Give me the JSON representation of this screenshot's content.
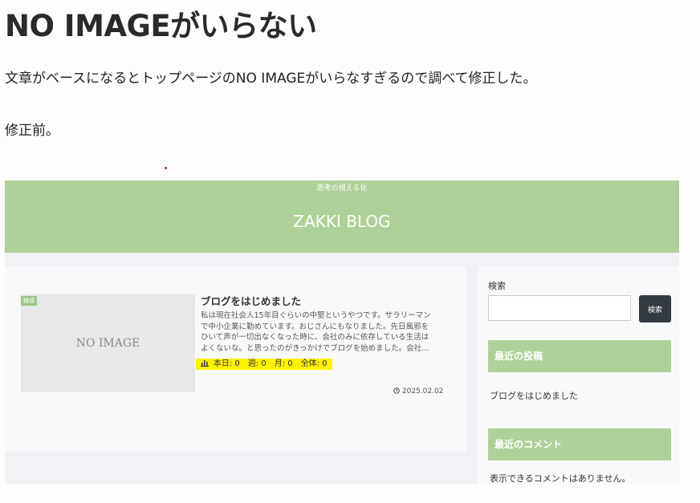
{
  "article": {
    "title": "NO IMAGEがいらない",
    "para1": "文章がベースになるとトップページのNO IMAGEがいらなすぎるので調べて修正した。",
    "para2": "修正前。"
  },
  "screenshot": {
    "tagline": "思考の視える化",
    "blog_title": "ZAKKI BLOG",
    "post": {
      "category": "雑感",
      "noimage_text": "NO IMAGE",
      "title": "ブログをはじめました",
      "excerpt": [
        "私は現在社会人15年目ぐらいの中堅というやつです。サラリーマン",
        "で中小企業に勤めています。おじさんにもなりました。先日風邪を",
        "ひいて声が一切出なくなった時に、会社のみに依存している生活は",
        "よくないな。と思ったのがきっかけでブログを始めました。会社…"
      ],
      "views": "本日: 0　週: 0　月: 0　全体: 0",
      "date": "2025.02.02"
    },
    "sidebar": {
      "search_label": "検索",
      "search_placeholder": "",
      "search_button": "検索",
      "recent_heading": "最近の投稿",
      "recent_item": "ブログをはじめました",
      "comments_heading": "最近のコメント",
      "no_comments": "表示できるコメントはありません。"
    },
    "colors": {
      "accent_green": "#aed199",
      "highlight_yellow": "#fff100",
      "search_button_bg": "#333a41"
    },
    "icons": [
      "bar-chart-icon",
      "clock-icon"
    ]
  }
}
